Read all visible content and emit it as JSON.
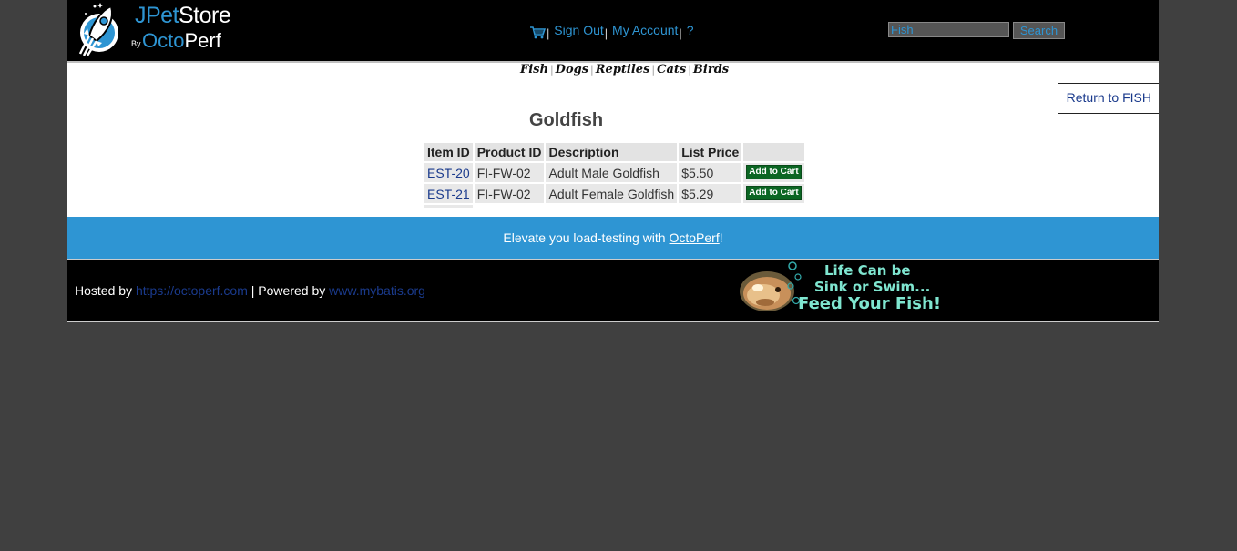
{
  "header": {
    "logo": {
      "line1_dark": "J",
      "line1_blue": "Pet",
      "line1_white": "Store",
      "by": "By",
      "line2_blue": "Octo",
      "line2_white": "Perf"
    },
    "menu": {
      "cart_icon": "cart-icon",
      "sign_out": "Sign Out",
      "my_account": "My Account",
      "help": "?",
      "separator": "|"
    },
    "search": {
      "value": "Fish",
      "button_label": "Search"
    }
  },
  "quicklinks": [
    "Fish",
    "Dogs",
    "Reptiles",
    "Cats",
    "Birds"
  ],
  "content": {
    "return_link": "Return to FISH",
    "product_title": "Goldfish",
    "table": {
      "headers": [
        "Item ID",
        "Product ID",
        "Description",
        "List Price",
        ""
      ],
      "rows": [
        {
          "item_id": "EST-20",
          "product_id": "FI-FW-02",
          "description": "Adult Male Goldfish",
          "price": "$5.50",
          "action": "Add to Cart"
        },
        {
          "item_id": "EST-21",
          "product_id": "FI-FW-02",
          "description": "Adult Female Goldfish",
          "price": "$5.29",
          "action": "Add to Cart"
        }
      ]
    }
  },
  "promo": {
    "prefix": "Elevate you load-testing with ",
    "link": "OctoPerf",
    "suffix": "!"
  },
  "footer": {
    "hosted_by": "Hosted by ",
    "hosted_link": "https://octoperf.com",
    "powered_sep": " | Powered by ",
    "powered_link": "www.mybatis.org",
    "banner_lines": [
      "Life Can be",
      "Sink or Swim...",
      "Feed Your Fish!"
    ]
  },
  "colors": {
    "accent": "#2e95d3",
    "header_bg": "#000000",
    "page_bg": "#404040",
    "add_button": "#0b6623",
    "link": "#1a3a8c"
  }
}
